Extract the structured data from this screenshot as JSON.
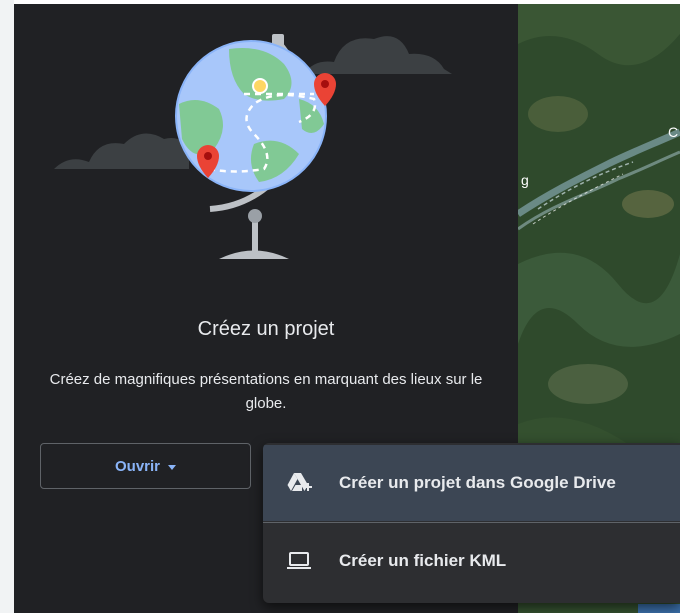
{
  "project_panel": {
    "title": "Créez un projet",
    "description": "Créez de magnifiques présentations en marquant des lieux sur le globe.",
    "open_button": {
      "label": "Ouvrir"
    }
  },
  "create_menu": {
    "items": [
      {
        "label": "Créer un projet dans Google Drive",
        "icon": "google-drive-add-icon",
        "highlighted": true
      },
      {
        "label": "Créer un fichier KML",
        "icon": "laptop-icon",
        "highlighted": false
      }
    ]
  },
  "map": {
    "edge_labels": [
      "g",
      "C"
    ]
  },
  "colors": {
    "panel_bg": "#202124",
    "menu_bg": "#2d2e31",
    "menu_highlight": "#3c4654",
    "accent_blue": "#8ab4f8",
    "text": "#e8eaed"
  }
}
